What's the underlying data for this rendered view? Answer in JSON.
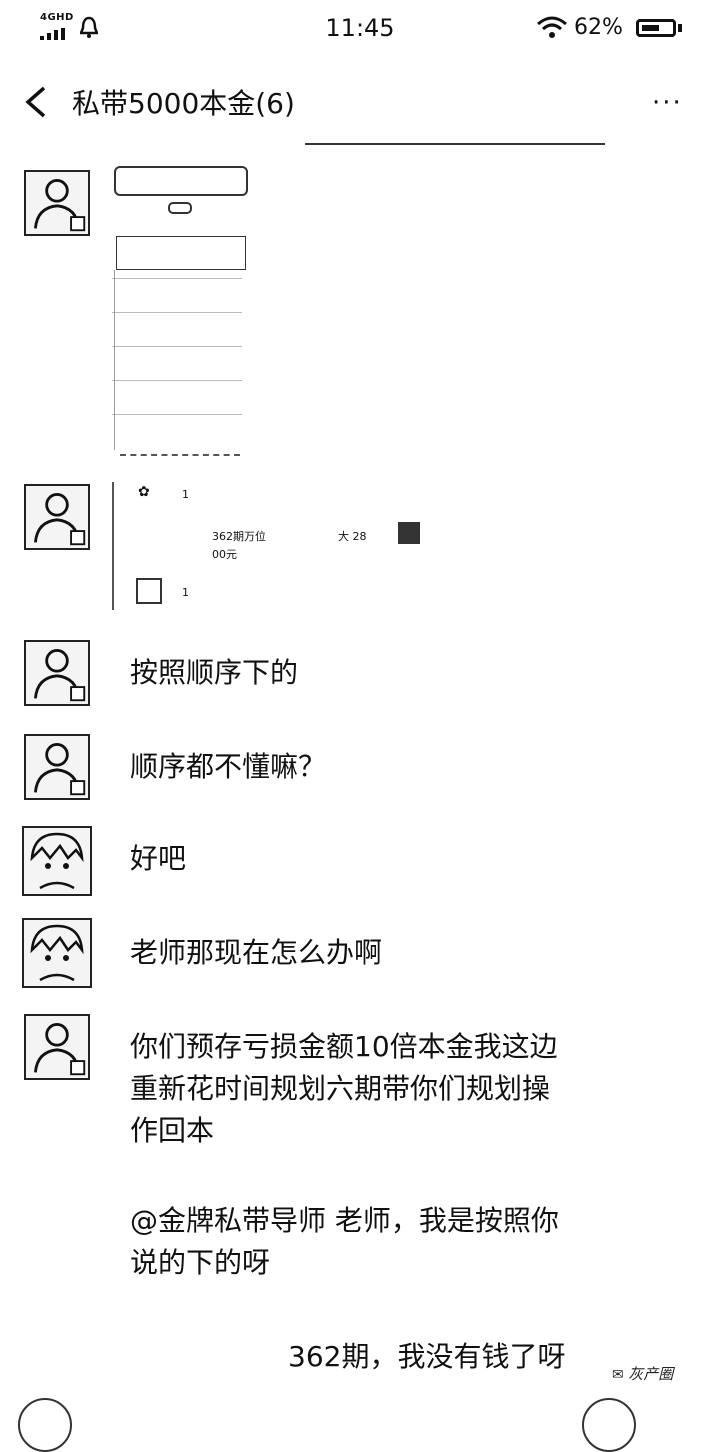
{
  "status": {
    "network": "4GHD",
    "time": "11:45",
    "battery": "62%",
    "battery_level": 0.62
  },
  "header": {
    "title": "私带5000本金(6)",
    "more_label": "···"
  },
  "forward_card": {
    "count_top": "1",
    "line1": "362期万位",
    "line1_value": "大  28",
    "line2": "00元",
    "count_bottom": "1"
  },
  "messages": [
    {
      "text": "按照顺序下的"
    },
    {
      "text": "顺序都不懂嘛？"
    },
    {
      "text": "好吧"
    },
    {
      "text": "老师那现在怎么办啊"
    },
    {
      "text": "你们预存亏损金额10倍本金我这边"
    },
    {
      "text": "重新花时间规划六期带你们规划操"
    },
    {
      "text": "作回本"
    },
    {
      "text": "@金牌私带导师  老师，我是按照你"
    },
    {
      "text": "说的下的呀"
    },
    {
      "text": "362期，我没有钱了呀"
    }
  ],
  "watermark": "灰产圈"
}
